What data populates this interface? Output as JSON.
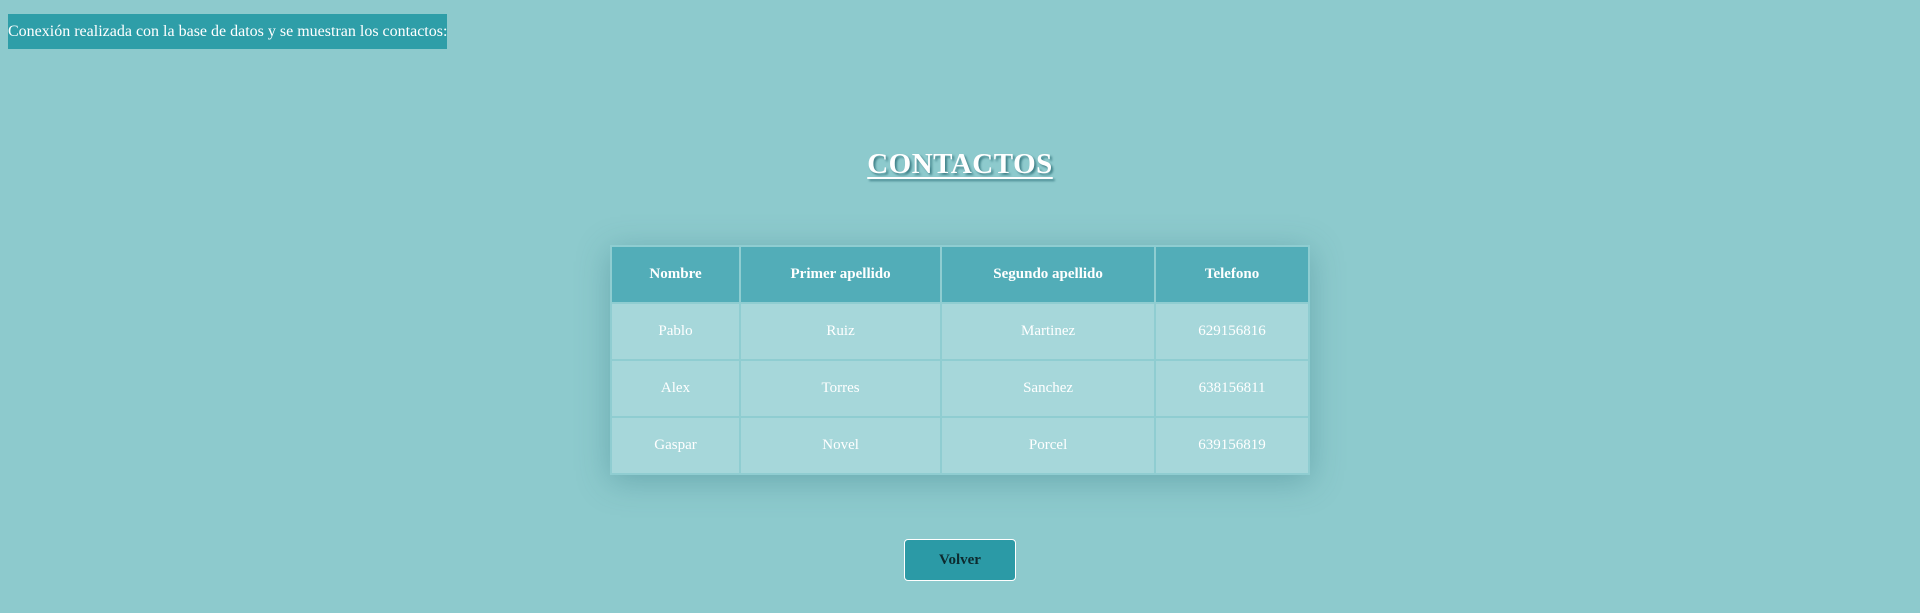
{
  "status": {
    "message": "Conexión realizada con la base de datos y se muestran los contactos:"
  },
  "page": {
    "title": "CONTACTOS"
  },
  "table": {
    "headers": [
      "Nombre",
      "Primer apellido",
      "Segundo apellido",
      "Telefono"
    ],
    "rows": [
      [
        "Pablo",
        "Ruiz",
        "Martinez",
        "629156816"
      ],
      [
        "Alex",
        "Torres",
        "Sanchez",
        "638156811"
      ],
      [
        "Gaspar",
        "Novel",
        "Porcel",
        "639156819"
      ]
    ]
  },
  "actions": {
    "back_label": "Volver"
  },
  "colors": {
    "background": "#8dcacd",
    "banner": "#2e9ea8",
    "table_header": "#52adb8",
    "table_cell": "#a6d7da",
    "button": "#2b9aa6"
  }
}
